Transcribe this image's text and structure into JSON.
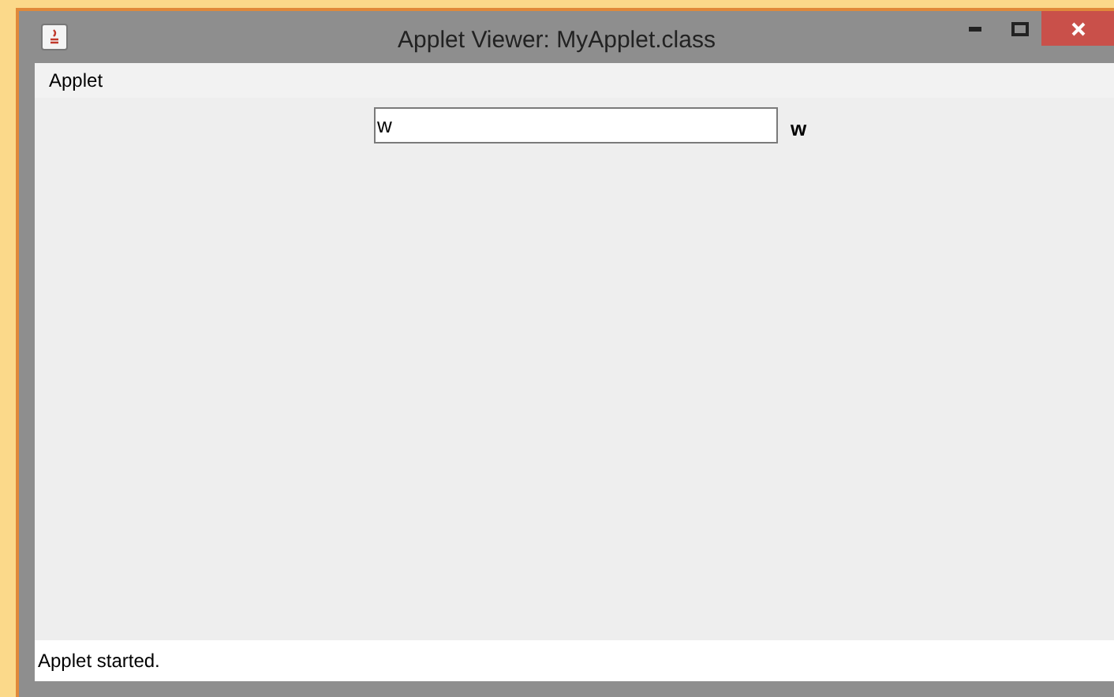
{
  "window": {
    "title": "Applet Viewer: MyApplet.class"
  },
  "menu": [
    "Applet"
  ],
  "text_field": {
    "value": "w"
  },
  "label": "w",
  "status_bar": "Applet started."
}
